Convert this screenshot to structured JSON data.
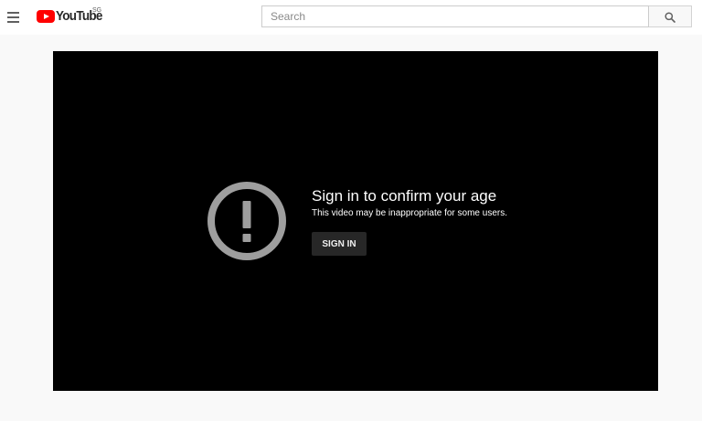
{
  "header": {
    "logo_text": "YouTube",
    "logo_region": "SG",
    "search": {
      "placeholder": "Search",
      "value": ""
    }
  },
  "player": {
    "message_title": "Sign in to confirm your age",
    "message_subtitle": "This video may be inappropriate for some users.",
    "signin_label": "SIGN IN"
  },
  "icons": {
    "menu": "hamburger-menu-icon",
    "logo": "youtube-logo-icon",
    "search": "search-icon",
    "warning": "exclamation-circle-icon"
  },
  "colors": {
    "brand": "#ff0000",
    "page_bg": "#f9f9f9",
    "player_bg": "#000000",
    "button_bg": "#272727",
    "warning_icon": "#9e9e9e"
  }
}
